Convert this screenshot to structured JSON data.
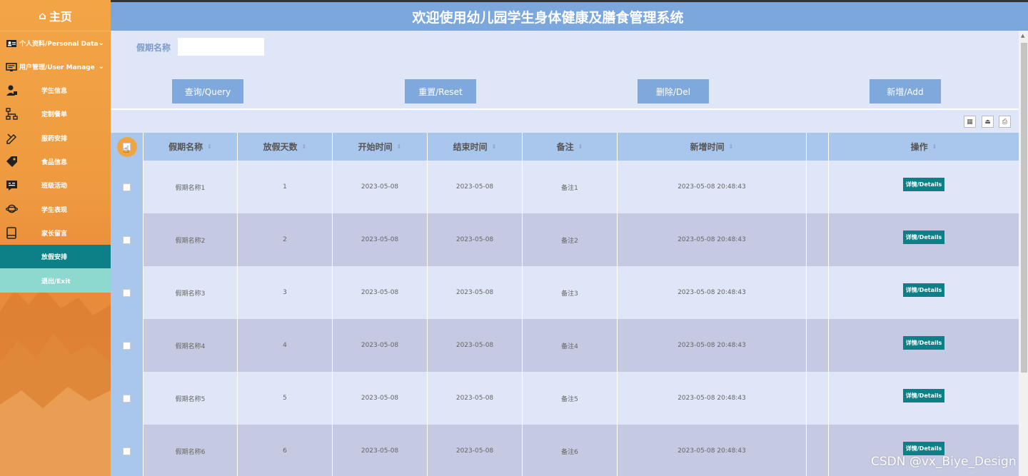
{
  "header": {
    "title": "欢迎使用幼儿园学生身体健康及膳食管理系统"
  },
  "sidebar": {
    "home_label": "主页",
    "groups": [
      {
        "label": "个人资料/Personal Data",
        "icon": "id-card-icon"
      },
      {
        "label": "用户管理/User Manage",
        "icon": "monitor-icon"
      }
    ],
    "items": [
      {
        "label": "学生信息",
        "icon": "user-lock-icon"
      },
      {
        "label": "定制餐单",
        "icon": "sitemap-icon"
      },
      {
        "label": "服药安排",
        "icon": "pencil-ruler-icon"
      },
      {
        "label": "食品信息",
        "icon": "tag-icon"
      },
      {
        "label": "班级活动",
        "icon": "message-icon"
      },
      {
        "label": "学生表现",
        "icon": "planet-icon"
      },
      {
        "label": "家长留言",
        "icon": "book-icon"
      },
      {
        "label": "放假安排",
        "icon": ""
      },
      {
        "label": "退出/Exit",
        "icon": ""
      }
    ]
  },
  "search": {
    "label": "假期名称",
    "value": ""
  },
  "buttons": {
    "query": "查询/Query",
    "reset": "重置/Reset",
    "delete": "删除/Del",
    "add": "新增/Add"
  },
  "table": {
    "headers": [
      "假期名称",
      "放假天数",
      "开始时间",
      "结束时间",
      "备注",
      "新增时间",
      "操作"
    ],
    "detail_label": "详情/Details",
    "rows": [
      {
        "name": "假期名称1",
        "days": "1",
        "start": "2023-05-08",
        "end": "2023-05-08",
        "note": "备注1",
        "added": "2023-05-08 20:48:43"
      },
      {
        "name": "假期名称2",
        "days": "2",
        "start": "2023-05-08",
        "end": "2023-05-08",
        "note": "备注2",
        "added": "2023-05-08 20:48:43"
      },
      {
        "name": "假期名称3",
        "days": "3",
        "start": "2023-05-08",
        "end": "2023-05-08",
        "note": "备注3",
        "added": "2023-05-08 20:48:43"
      },
      {
        "name": "假期名称4",
        "days": "4",
        "start": "2023-05-08",
        "end": "2023-05-08",
        "note": "备注4",
        "added": "2023-05-08 20:48:43"
      },
      {
        "name": "假期名称5",
        "days": "5",
        "start": "2023-05-08",
        "end": "2023-05-08",
        "note": "备注5",
        "added": "2023-05-08 20:48:43"
      },
      {
        "name": "假期名称6",
        "days": "6",
        "start": "2023-05-08",
        "end": "2023-05-08",
        "note": "备注6",
        "added": "2023-05-08 20:48:43"
      }
    ]
  },
  "watermark": "CSDN @vx_Biye_Design"
}
